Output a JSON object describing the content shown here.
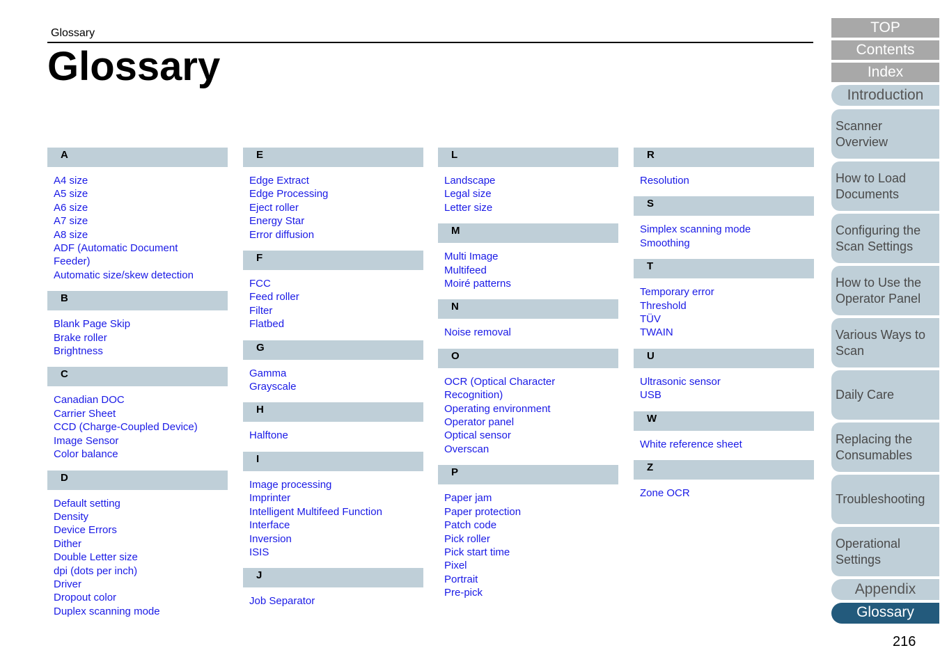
{
  "header": {
    "breadcrumb": "Glossary",
    "title": "Glossary"
  },
  "columns": [
    [
      {
        "letter": "A",
        "terms": [
          "A4 size",
          "A5 size",
          "A6 size",
          "A7 size",
          "A8 size",
          "ADF (Automatic Document",
          "Feeder)",
          "Automatic size/skew detection"
        ]
      },
      {
        "letter": "B",
        "terms": [
          "Blank Page Skip",
          "Brake roller",
          "Brightness"
        ]
      },
      {
        "letter": "C",
        "terms": [
          "Canadian DOC",
          "Carrier Sheet",
          "CCD (Charge-Coupled Device)",
          "Image Sensor",
          "Color balance"
        ]
      },
      {
        "letter": "D",
        "terms": [
          "Default setting",
          "Density",
          "Device Errors",
          "Dither",
          "Double Letter size",
          "dpi (dots per inch)",
          "Driver",
          "Dropout color",
          "Duplex scanning mode"
        ]
      }
    ],
    [
      {
        "letter": "E",
        "terms": [
          "Edge Extract",
          "Edge Processing",
          "Eject roller",
          "Energy Star",
          "Error diffusion"
        ]
      },
      {
        "letter": "F",
        "terms": [
          "FCC",
          "Feed roller",
          "Filter",
          "Flatbed"
        ]
      },
      {
        "letter": "G",
        "terms": [
          "Gamma",
          "Grayscale"
        ]
      },
      {
        "letter": "H",
        "terms": [
          "Halftone"
        ]
      },
      {
        "letter": "I",
        "terms": [
          "Image processing",
          "Imprinter",
          "Intelligent Multifeed Function",
          "Interface",
          "Inversion",
          "ISIS"
        ]
      },
      {
        "letter": "J",
        "terms": [
          "Job Separator"
        ]
      }
    ],
    [
      {
        "letter": "L",
        "terms": [
          "Landscape",
          "Legal size",
          "Letter size"
        ]
      },
      {
        "letter": "M",
        "terms": [
          "Multi Image",
          "Multifeed",
          "Moiré patterns"
        ]
      },
      {
        "letter": "N",
        "terms": [
          "Noise removal"
        ]
      },
      {
        "letter": "O",
        "terms": [
          "OCR (Optical Character",
          "Recognition)",
          "Operating environment",
          "Operator panel",
          "Optical sensor",
          "Overscan"
        ]
      },
      {
        "letter": "P",
        "terms": [
          "Paper jam",
          "Paper protection",
          "Patch code",
          "Pick roller",
          "Pick start time",
          "Pixel",
          "Portrait",
          "Pre-pick"
        ]
      }
    ],
    [
      {
        "letter": "R",
        "terms": [
          "Resolution"
        ]
      },
      {
        "letter": "S",
        "terms": [
          "Simplex scanning mode",
          "Smoothing"
        ]
      },
      {
        "letter": "T",
        "terms": [
          "Temporary error",
          "Threshold",
          "TÜV",
          "TWAIN"
        ]
      },
      {
        "letter": "U",
        "terms": [
          "Ultrasonic sensor",
          "USB"
        ]
      },
      {
        "letter": "W",
        "terms": [
          "White reference sheet"
        ]
      },
      {
        "letter": "Z",
        "terms": [
          "Zone OCR"
        ]
      }
    ]
  ],
  "nav": {
    "top": "TOP",
    "contents": "Contents",
    "index": "Index",
    "introduction": "Introduction",
    "chapters": [
      "Scanner\nOverview",
      "How to Load\nDocuments",
      "Configuring the\nScan Settings",
      "How to Use the\nOperator Panel",
      "Various Ways to\nScan",
      "Daily Care",
      "Replacing the\nConsumables",
      "Troubleshooting",
      "Operational\nSettings"
    ],
    "appendix": "Appendix",
    "glossary": "Glossary"
  },
  "colors": {
    "section_header_bg": "#bfcfd8",
    "link": "#1a1ae6",
    "nav_gray": "#a8a8a8",
    "nav_active": "#235a7c"
  },
  "page_number": "216"
}
